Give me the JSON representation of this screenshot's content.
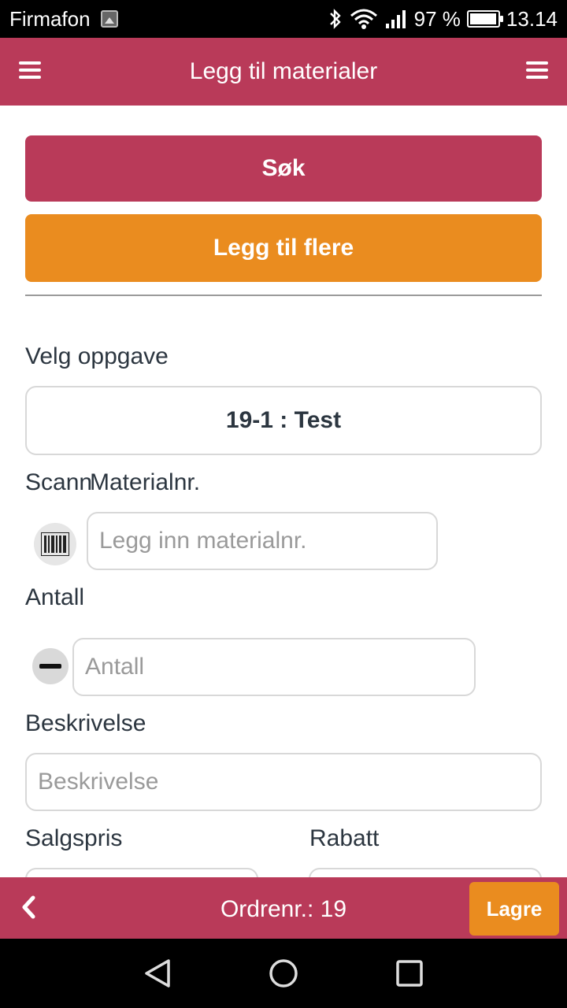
{
  "status_bar": {
    "carrier": "Firmafon",
    "battery_percent": "97 %",
    "battery_level": 0.97,
    "time": "13.14"
  },
  "header": {
    "title": "Legg til materialer",
    "menu_left_icon": "hamburger-menu-icon",
    "menu_right_icon": "hamburger-menu-icon"
  },
  "actions": {
    "search_label": "Søk",
    "add_more_label": "Legg til flere"
  },
  "form": {
    "task_label": "Velg oppgave",
    "task_value": "19-1 : Test",
    "scan_label": "Scann",
    "material_label": "Materialnr.",
    "material_placeholder": "Legg inn materialnr.",
    "quantity_label": "Antall",
    "quantity_placeholder": "Antall",
    "description_label": "Beskrivelse",
    "description_placeholder": "Beskrivelse",
    "price_label": "Salgspris",
    "discount_label": "Rabatt"
  },
  "footer": {
    "order_text": "Ordrenr.: 19",
    "save_label": "Lagre"
  },
  "colors": {
    "brand": "#b93a59",
    "accent": "#ea8c1f",
    "text": "#2c3640"
  }
}
